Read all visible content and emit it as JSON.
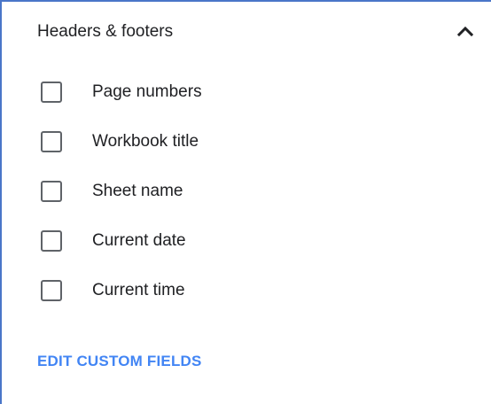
{
  "section": {
    "title": "Headers & footers",
    "toggle_icon": "chevron-up-icon"
  },
  "options": [
    {
      "label": "Page numbers",
      "checked": false
    },
    {
      "label": "Workbook title",
      "checked": false
    },
    {
      "label": "Sheet name",
      "checked": false
    },
    {
      "label": "Current date",
      "checked": false
    },
    {
      "label": "Current time",
      "checked": false
    }
  ],
  "actions": {
    "edit_custom_fields": "EDIT CUSTOM FIELDS"
  },
  "colors": {
    "border_accent": "#4a76c8",
    "link": "#4285f4",
    "checkbox_border": "#5f6368",
    "text": "#202124"
  }
}
